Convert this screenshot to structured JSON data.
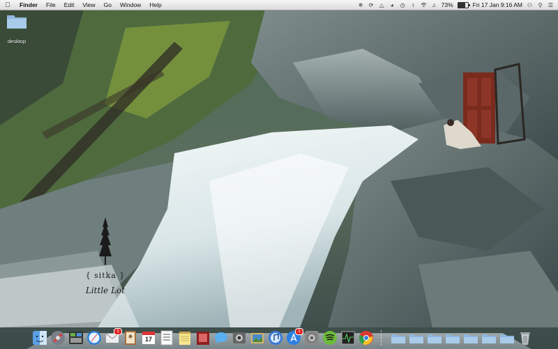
{
  "menubar": {
    "apple_icon": "apple-logo-icon",
    "app_name": "Finder",
    "menus": [
      "File",
      "Edit",
      "View",
      "Go",
      "Window",
      "Help"
    ],
    "status_icons": [
      "evernote-icon",
      "sync-icon",
      "google-drive-icon",
      "time-machine-icon",
      "clock-icon",
      "bluetooth-icon",
      "wifi-icon",
      "volume-icon"
    ],
    "battery_percent": 73,
    "battery_label": "73%",
    "datetime": "Fri 17 Jan  9:16 AM",
    "user_icon": "user-icon",
    "spotlight_icon": "spotlight-search-icon",
    "list_icon": "notification-list-icon"
  },
  "desktop": {
    "folder_label": "desktop"
  },
  "wallpaper": {
    "logo_word": "{ sitka }",
    "logo_script": "Little Lot"
  },
  "dock": {
    "apps": [
      {
        "name": "finder",
        "icon": "finder-icon"
      },
      {
        "name": "launchpad",
        "icon": "launchpad-icon"
      },
      {
        "name": "mission-control",
        "icon": "mission-control-icon"
      },
      {
        "name": "safari",
        "icon": "safari-icon"
      },
      {
        "name": "mail",
        "icon": "mail-icon",
        "badge": "1"
      },
      {
        "name": "contacts",
        "icon": "contacts-icon"
      },
      {
        "name": "calendar",
        "icon": "calendar-icon",
        "day": "17"
      },
      {
        "name": "reminders",
        "icon": "reminders-icon"
      },
      {
        "name": "notes",
        "icon": "notes-icon"
      },
      {
        "name": "photo-booth",
        "icon": "photo-booth-icon"
      },
      {
        "name": "messages",
        "icon": "messages-icon"
      },
      {
        "name": "facetime",
        "icon": "facetime-icon"
      },
      {
        "name": "iphoto",
        "icon": "iphoto-icon"
      },
      {
        "name": "itunes",
        "icon": "itunes-icon"
      },
      {
        "name": "app-store",
        "icon": "app-store-icon",
        "badge": "1"
      },
      {
        "name": "system-preferences",
        "icon": "system-preferences-icon"
      },
      {
        "name": "spotify",
        "icon": "spotify-icon"
      },
      {
        "name": "activity-monitor",
        "icon": "activity-monitor-icon"
      },
      {
        "name": "chrome",
        "icon": "chrome-icon"
      }
    ],
    "stacks": [
      {
        "name": "stack-1",
        "icon": "folder-stack-icon"
      },
      {
        "name": "stack-2",
        "icon": "folder-stack-icon"
      },
      {
        "name": "stack-3",
        "icon": "folder-stack-icon"
      },
      {
        "name": "stack-4",
        "icon": "folder-stack-icon"
      },
      {
        "name": "stack-5",
        "icon": "folder-stack-icon"
      },
      {
        "name": "stack-6",
        "icon": "folder-stack-icon"
      },
      {
        "name": "stack-7",
        "icon": "folder-stack-icon"
      },
      {
        "name": "trash",
        "icon": "trash-icon"
      }
    ]
  },
  "colors": {
    "accent": "#2f6fd6",
    "badge": "#e02525"
  }
}
